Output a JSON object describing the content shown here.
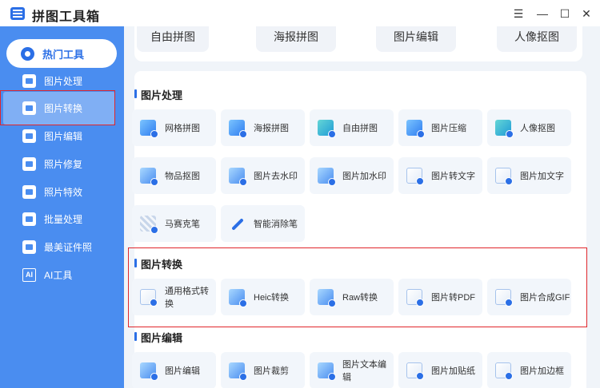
{
  "app": {
    "title": "拼图工具箱",
    "controls": [
      "☰",
      "—",
      "☐",
      "✕"
    ]
  },
  "sidebar": {
    "items": [
      {
        "label": "热门工具"
      },
      {
        "label": "图片处理"
      },
      {
        "label": "图片转换"
      },
      {
        "label": "图片编辑"
      },
      {
        "label": "照片修复"
      },
      {
        "label": "照片特效"
      },
      {
        "label": "批量处理"
      },
      {
        "label": "最美证件照"
      },
      {
        "label": "AI工具",
        "icon_text": "AI"
      }
    ]
  },
  "top_tools": [
    "自由拼图",
    "海报拼图",
    "图片编辑",
    "人像抠图"
  ],
  "sections": [
    {
      "title": "图片处理",
      "tools": [
        "网格拼图",
        "海报拼图",
        "自由拼图",
        "图片压缩",
        "人像抠图",
        "物品抠图",
        "图片去水印",
        "图片加水印",
        "图片转文字",
        "图片加文字",
        "马赛克笔",
        "智能消除笔"
      ]
    },
    {
      "title": "图片转换",
      "tools": [
        "通用格式转换",
        "Heic转换",
        "Raw转换",
        "图片转PDF",
        "图片合成GIF"
      ]
    },
    {
      "title": "图片编辑",
      "tools": [
        "图片编辑",
        "图片裁剪",
        "图片文本编辑",
        "图片加贴纸",
        "图片加边框"
      ]
    }
  ],
  "colors": {
    "accent": "#2b6fe6",
    "sidebar_bg": "#4a8df0",
    "content_bg": "#f0f4f9",
    "highlight": "#e0262b"
  }
}
